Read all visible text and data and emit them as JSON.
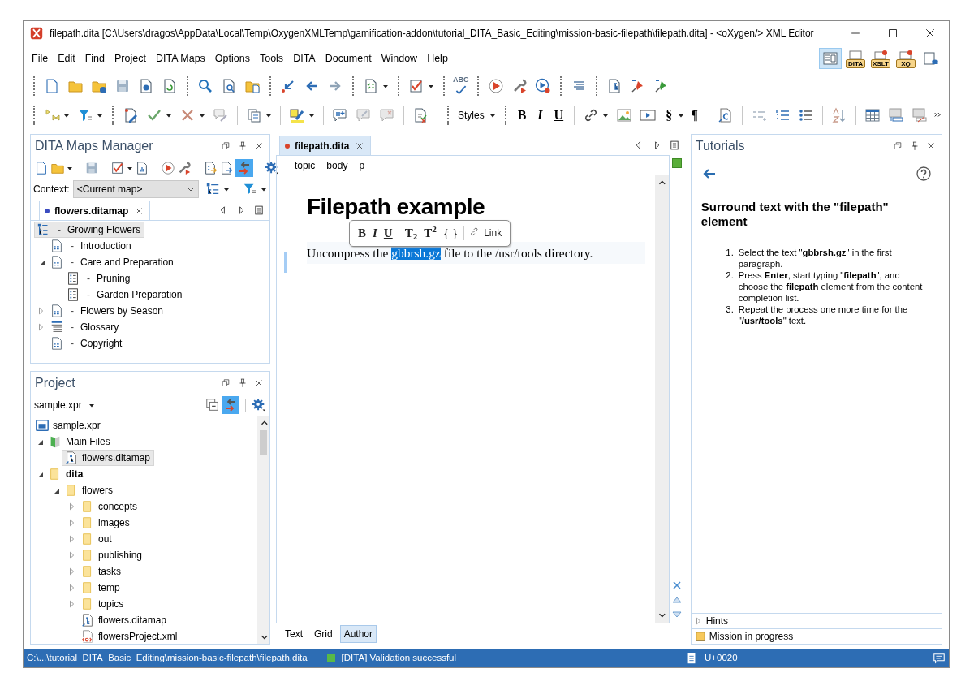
{
  "window": {
    "title": "filepath.dita [C:\\Users\\dragos\\AppData\\Local\\Temp\\OxygenXMLTemp\\gamification-addon\\tutorial_DITA_Basic_Editing\\mission-basic-filepath\\filepath.dita] - <oXygen/> XML Editor"
  },
  "menu": [
    {
      "label": "File"
    },
    {
      "label": "Edit"
    },
    {
      "label": "Find"
    },
    {
      "label": "Project"
    },
    {
      "label": "DITA Maps"
    },
    {
      "label": "Options"
    },
    {
      "label": "Tools"
    },
    {
      "label": "DITA"
    },
    {
      "label": "Document"
    },
    {
      "label": "Window"
    },
    {
      "label": "Help"
    }
  ],
  "perspectives": [
    {
      "kind": "editor",
      "selected": true
    },
    {
      "kind": "badge",
      "label": "DITA",
      "selected": false
    },
    {
      "kind": "debugger",
      "label": "XSLT",
      "selected": false
    },
    {
      "kind": "debugger",
      "label": "XQ",
      "selected": false
    },
    {
      "kind": "database",
      "selected": false
    }
  ],
  "toolbar_1": {
    "spell_check_label": "ABC"
  },
  "toolbar_2": {
    "styles_label": "Styles",
    "format": [
      {
        "label": "B",
        "kind": "bold"
      },
      {
        "label": "I",
        "kind": "italic"
      },
      {
        "label": "U",
        "kind": "underline"
      }
    ],
    "section": "§",
    "pilcrow": "¶"
  },
  "dita_maps_manager": {
    "title": "DITA Maps Manager",
    "link_with_editor": true,
    "context_label": "Context:",
    "context_value": "<Current map>",
    "tab": {
      "label": "flowers.ditamap",
      "modified": true
    },
    "tree": [
      {
        "label": "Growing Flowers",
        "kind": "map",
        "dash": "-",
        "selected": true,
        "children": [
          {
            "label": "Introduction",
            "kind": "topic",
            "dash": "-",
            "selected": false
          },
          {
            "label": "Care and Preparation",
            "kind": "topic",
            "dash": "-",
            "selected": false,
            "expanded": true,
            "children": [
              {
                "label": "Pruning",
                "kind": "task",
                "dash": "-",
                "selected": false
              },
              {
                "label": "Garden Preparation",
                "kind": "task",
                "dash": "-",
                "selected": false
              }
            ]
          },
          {
            "label": "Flowers by Season",
            "kind": "topic",
            "dash": "-",
            "selected": false,
            "expanded": false
          },
          {
            "label": "Glossary",
            "kind": "glossary",
            "dash": "-",
            "selected": false,
            "expanded": false
          },
          {
            "label": "Copyright",
            "kind": "topic",
            "dash": "-",
            "selected": false
          }
        ]
      }
    ]
  },
  "project": {
    "title": "Project",
    "file": "sample.xpr",
    "link_with_editor": true,
    "tree": [
      {
        "label": "sample.xpr",
        "kind": "project",
        "selected": false,
        "children": [
          {
            "label": "Main Files",
            "kind": "main_files",
            "selected": false,
            "expanded": true,
            "children": [
              {
                "label": "flowers.ditamap",
                "kind": "map_file",
                "selected": true
              }
            ]
          },
          {
            "label": "dita",
            "kind": "folder",
            "emphasized": true,
            "selected": false,
            "expanded": true,
            "children": [
              {
                "label": "flowers",
                "kind": "folder",
                "selected": false,
                "expanded": true,
                "children": [
                  {
                    "label": "concepts",
                    "kind": "folder",
                    "selected": false,
                    "expanded": false
                  },
                  {
                    "label": "images",
                    "kind": "folder",
                    "selected": false,
                    "expanded": false
                  },
                  {
                    "label": "out",
                    "kind": "folder",
                    "selected": false,
                    "expanded": false
                  },
                  {
                    "label": "publishing",
                    "kind": "folder",
                    "selected": false,
                    "expanded": false
                  },
                  {
                    "label": "tasks",
                    "kind": "folder",
                    "selected": false,
                    "expanded": false
                  },
                  {
                    "label": "temp",
                    "kind": "folder",
                    "selected": false,
                    "expanded": false
                  },
                  {
                    "label": "topics",
                    "kind": "folder",
                    "selected": false,
                    "expanded": false
                  },
                  {
                    "label": "flowers.ditamap",
                    "kind": "map_file",
                    "selected": false
                  },
                  {
                    "label": "flowersProject.xml",
                    "kind": "xml",
                    "selected": false
                  }
                ]
              }
            ]
          }
        ]
      }
    ]
  },
  "editor": {
    "tab": {
      "label": "filepath.dita",
      "modified": true
    },
    "valid": true,
    "breadcrumb": [
      "topic",
      "body",
      "p"
    ],
    "heading": "Filepath example",
    "paragraph": {
      "before": "Uncompress the ",
      "selected": "gbbrsh.gz",
      "after": " file to the /usr/tools directory."
    },
    "popup": [
      [
        {
          "label": "B",
          "kind": "bold"
        },
        {
          "label": "I",
          "kind": "italic"
        },
        {
          "label": "U",
          "kind": "underline"
        }
      ],
      [
        {
          "label": "T$_{2}$",
          "kind": "subscript"
        },
        {
          "label": "T$^{2}$",
          "kind": "superscript"
        },
        {
          "label": "{ }",
          "kind": "code"
        }
      ],
      [
        {
          "label": "Link",
          "kind": "link"
        }
      ]
    ],
    "modes": [
      {
        "label": "Text",
        "selected": false
      },
      {
        "label": "Grid",
        "selected": false
      },
      {
        "label": "Author",
        "selected": true
      }
    ]
  },
  "tutorials": {
    "title": "Tutorials",
    "heading": "Surround text with the \"filepath\" element",
    "steps": [
      {
        "number": "1.",
        "text": "Select the text \"**gbbrsh.gz**\" in the first paragraph."
      },
      {
        "number": "2.",
        "text": "Press **Enter**, start typing \"**filepath**\", and choose the **filepath** element from the content completion list."
      },
      {
        "number": "3.",
        "text": "Repeat the process one more time for the \"**/usr/tools**\" text."
      }
    ],
    "hints": {
      "label": "Hints",
      "expanded": false
    },
    "mission": "Mission in progress"
  },
  "status_bar": {
    "path": "C:\\...\\tutorial_DITA_Basic_Editing\\mission-basic-filepath\\filepath.dita",
    "validation": {
      "text": "[DITA] Validation successful",
      "valid": true
    },
    "character": "U+0020"
  }
}
